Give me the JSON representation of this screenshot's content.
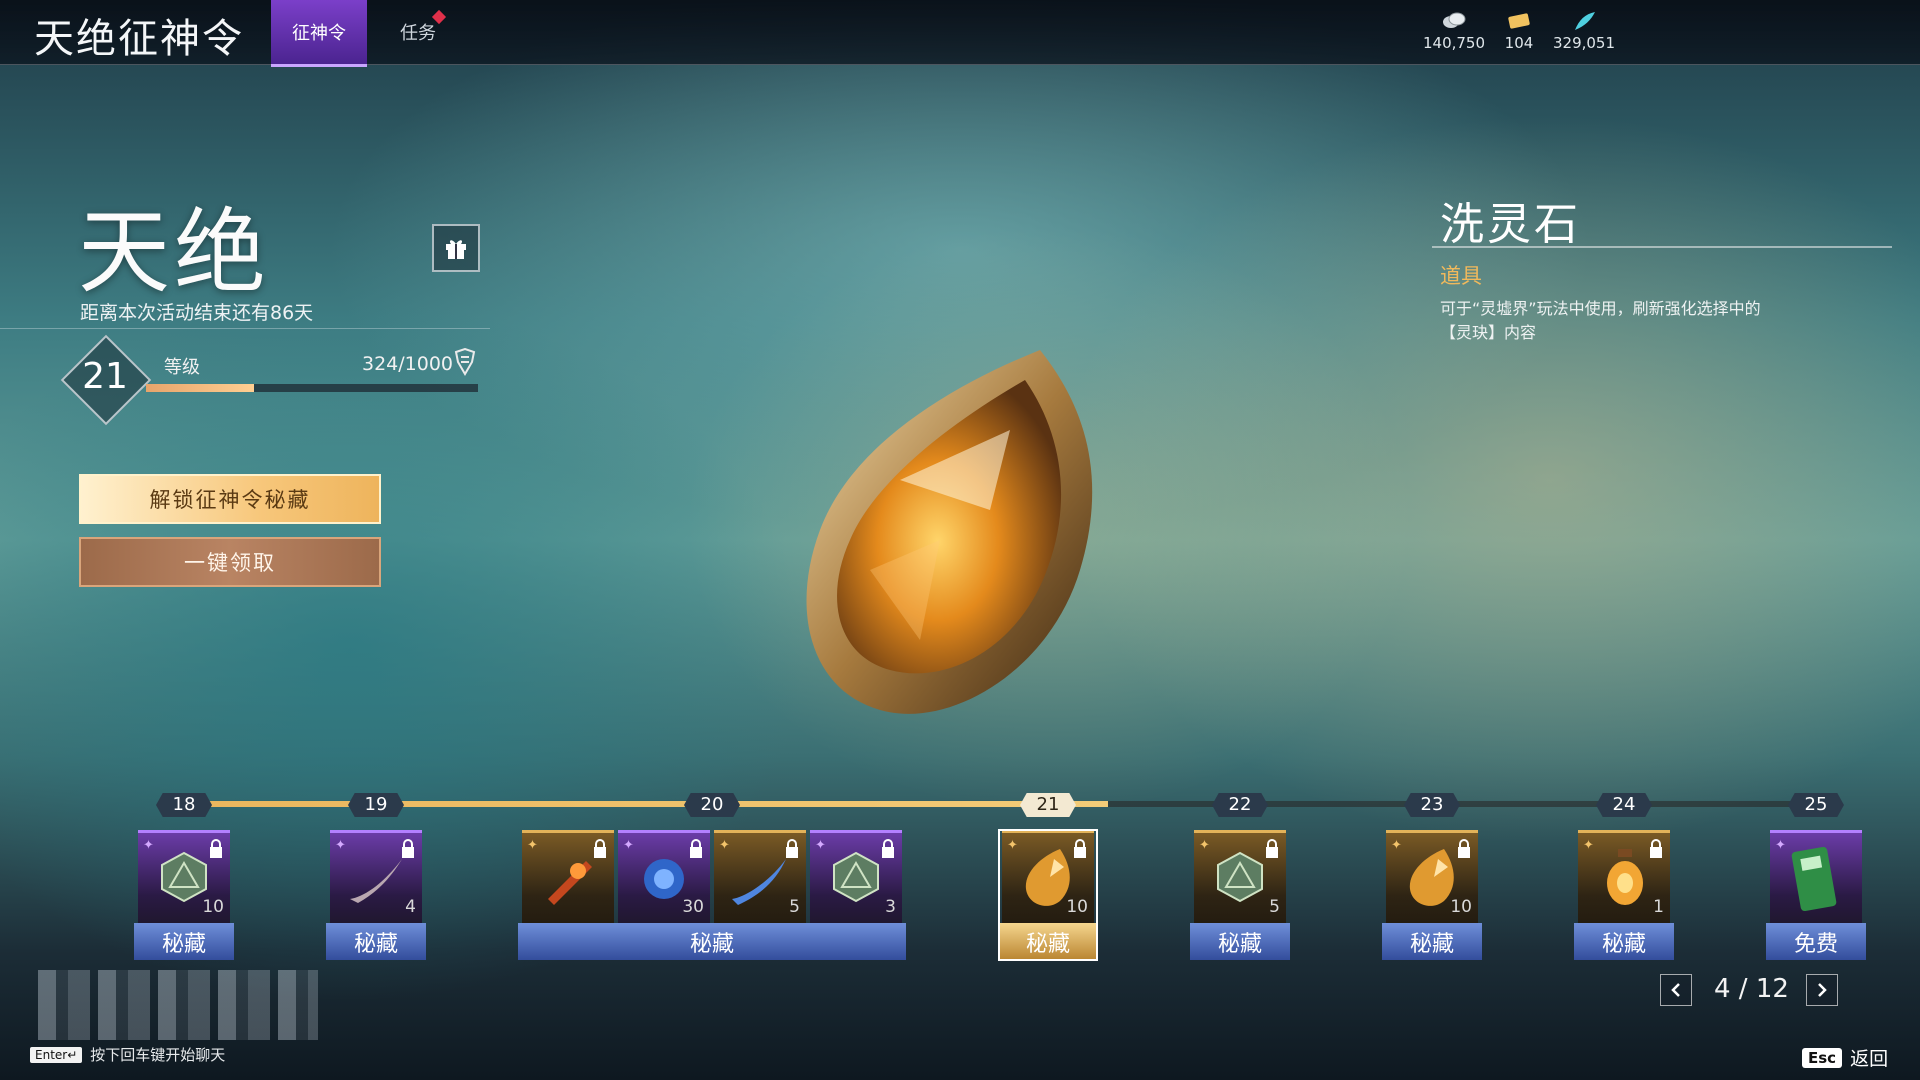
{
  "header": {
    "title": "天绝征神令",
    "tabs": [
      {
        "label": "征神令",
        "active": true
      },
      {
        "label": "任务",
        "active": false,
        "has_notification": true
      }
    ],
    "currencies": [
      {
        "icon": "coin-icon",
        "value": "140,750"
      },
      {
        "icon": "ticket-icon",
        "value": "104"
      },
      {
        "icon": "feather-icon",
        "value": "329,051"
      }
    ]
  },
  "season": {
    "name": "天绝",
    "countdown": "距离本次活动结束还有86天",
    "level": "21",
    "level_label": "等级",
    "exp": "324/1000",
    "exp_progress": 0.324
  },
  "actions": {
    "unlock_label": "解锁征神令秘藏",
    "claim_label": "一键领取"
  },
  "item_detail": {
    "name": "洗灵石",
    "type": "道具",
    "desc_line1": "可于“灵墟界”玩法中使用，刷新强化选择中的",
    "desc_line2": "【灵玦】内容"
  },
  "track": {
    "levels": [
      "18",
      "19",
      "20",
      "21",
      "22",
      "23",
      "24",
      "25"
    ],
    "current_level": "21",
    "rewards": [
      {
        "level": "18",
        "label": "秘藏",
        "items": [
          {
            "icon": "d20-dice-icon",
            "qty": "10",
            "locked": true
          }
        ]
      },
      {
        "level": "19",
        "label": "秘藏",
        "items": [
          {
            "icon": "claw-icon",
            "qty": "4",
            "locked": true
          }
        ]
      },
      {
        "level": "20",
        "label": "秘藏",
        "items": [
          {
            "icon": "flame-scroll-icon",
            "qty": "",
            "locked": true
          },
          {
            "icon": "blue-orb-icon",
            "qty": "30",
            "locked": true
          },
          {
            "icon": "blue-feather-icon",
            "qty": "5",
            "locked": true
          },
          {
            "icon": "d20-dice-icon",
            "qty": "3",
            "locked": true
          }
        ]
      },
      {
        "level": "21",
        "label": "秘藏",
        "items": [
          {
            "icon": "spirit-stone-icon",
            "qty": "10",
            "locked": true
          }
        ]
      },
      {
        "level": "22",
        "label": "秘藏",
        "items": [
          {
            "icon": "d20-dice-icon",
            "qty": "5",
            "locked": true
          }
        ]
      },
      {
        "level": "23",
        "label": "秘藏",
        "items": [
          {
            "icon": "spirit-stone-icon",
            "qty": "10",
            "locked": true
          }
        ]
      },
      {
        "level": "24",
        "label": "秘藏",
        "items": [
          {
            "icon": "amber-lantern-icon",
            "qty": "1",
            "locked": true
          }
        ]
      },
      {
        "level": "25",
        "label": "免费",
        "items": [
          {
            "icon": "green-card-icon",
            "qty": "",
            "locked": false
          }
        ]
      }
    ]
  },
  "pager": {
    "text": "4 / 12"
  },
  "footer": {
    "chat_key": "Enter↵",
    "chat_hint": "按下回车键开始聊天",
    "esc_key": "Esc",
    "back_label": "返回"
  }
}
